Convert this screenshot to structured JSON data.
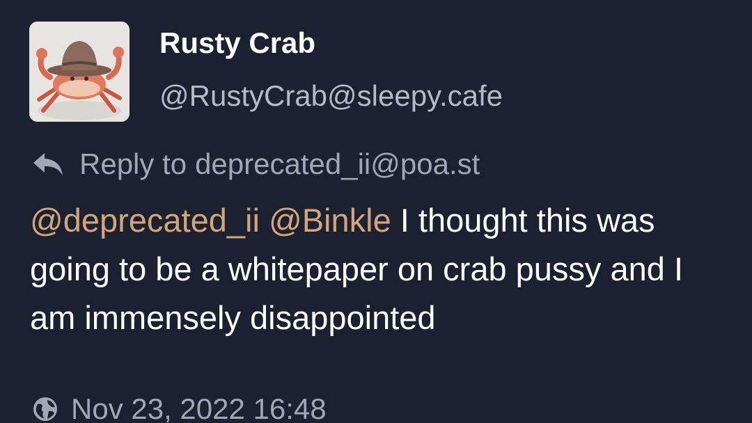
{
  "post": {
    "author": {
      "display_name": "Rusty Crab",
      "handle": "@RustyCrab@sleepy.cafe",
      "avatar_icon": "crab-with-cowboy-hat"
    },
    "reply": {
      "icon": "reply-arrow-icon",
      "prefix": "Reply to",
      "target": "deprecated_ii@poa.st"
    },
    "content": {
      "mention_1": "@deprecated_ii",
      "mention_2": "@Binkle",
      "text": "I thought this was going to be a whitepaper on crab pussy and I am immensely disappointed"
    },
    "meta": {
      "visibility_icon": "globe-icon",
      "timestamp": "Nov 23, 2022 16:48"
    }
  },
  "colors": {
    "background": "#1c2131",
    "mention": "#d4a576",
    "muted_text": "#a2a7b4",
    "primary_text": "#ffffff"
  }
}
